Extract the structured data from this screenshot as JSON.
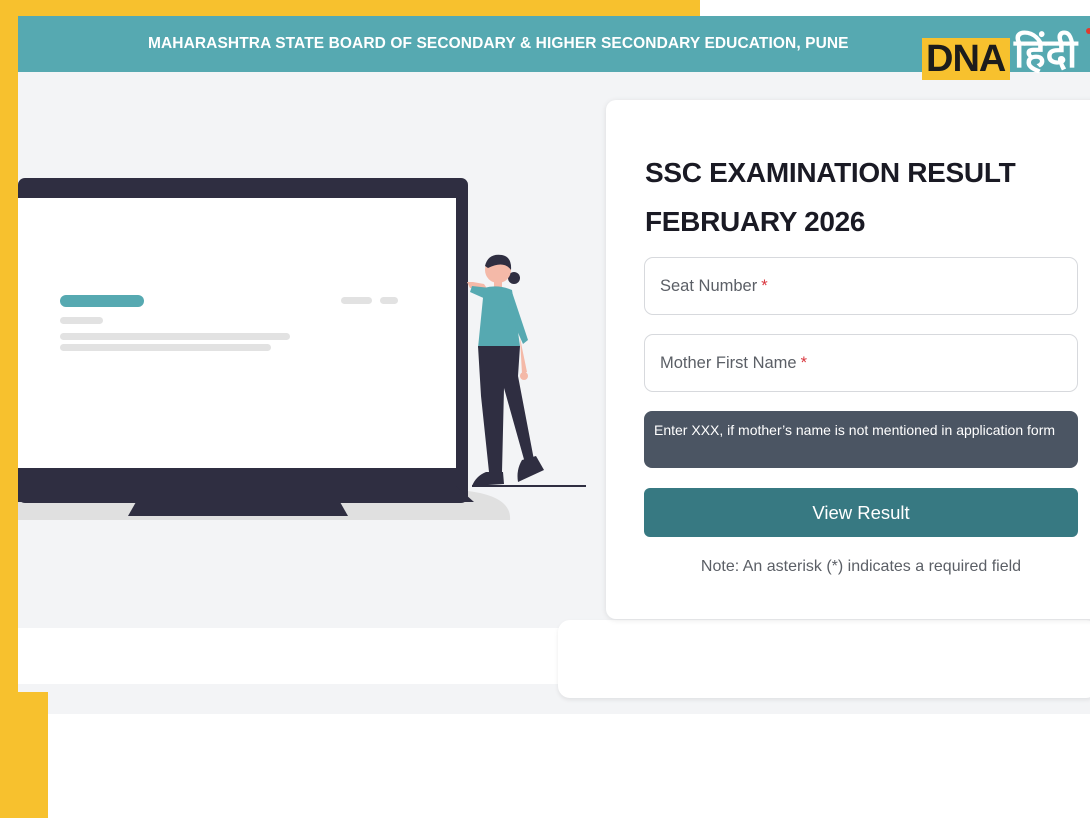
{
  "header": {
    "title": "MAHARASHTRA STATE BOARD OF SECONDARY & HIGHER SECONDARY EDUCATION, PUNE"
  },
  "logo": {
    "brand": "DNA",
    "script": "हिंदी"
  },
  "form": {
    "title": "SSC EXAMINATION RESULT FEBRUARY 2026",
    "seat_number_label": "Seat Number",
    "mother_name_label": "Mother First Name",
    "required_mark": "*",
    "hint": "Enter XXX, if mother’s name is not mentioned in application form",
    "submit_label": "View Result",
    "note": "Note: An asterisk (*) indicates a required field"
  },
  "colors": {
    "header": "#56a9b1",
    "button": "#377982",
    "hint_bg": "#4b5563",
    "frame": "#f7c12e",
    "required": "#d9363e"
  },
  "icons": {
    "illustration": "woman-with-laptop-illustration"
  }
}
